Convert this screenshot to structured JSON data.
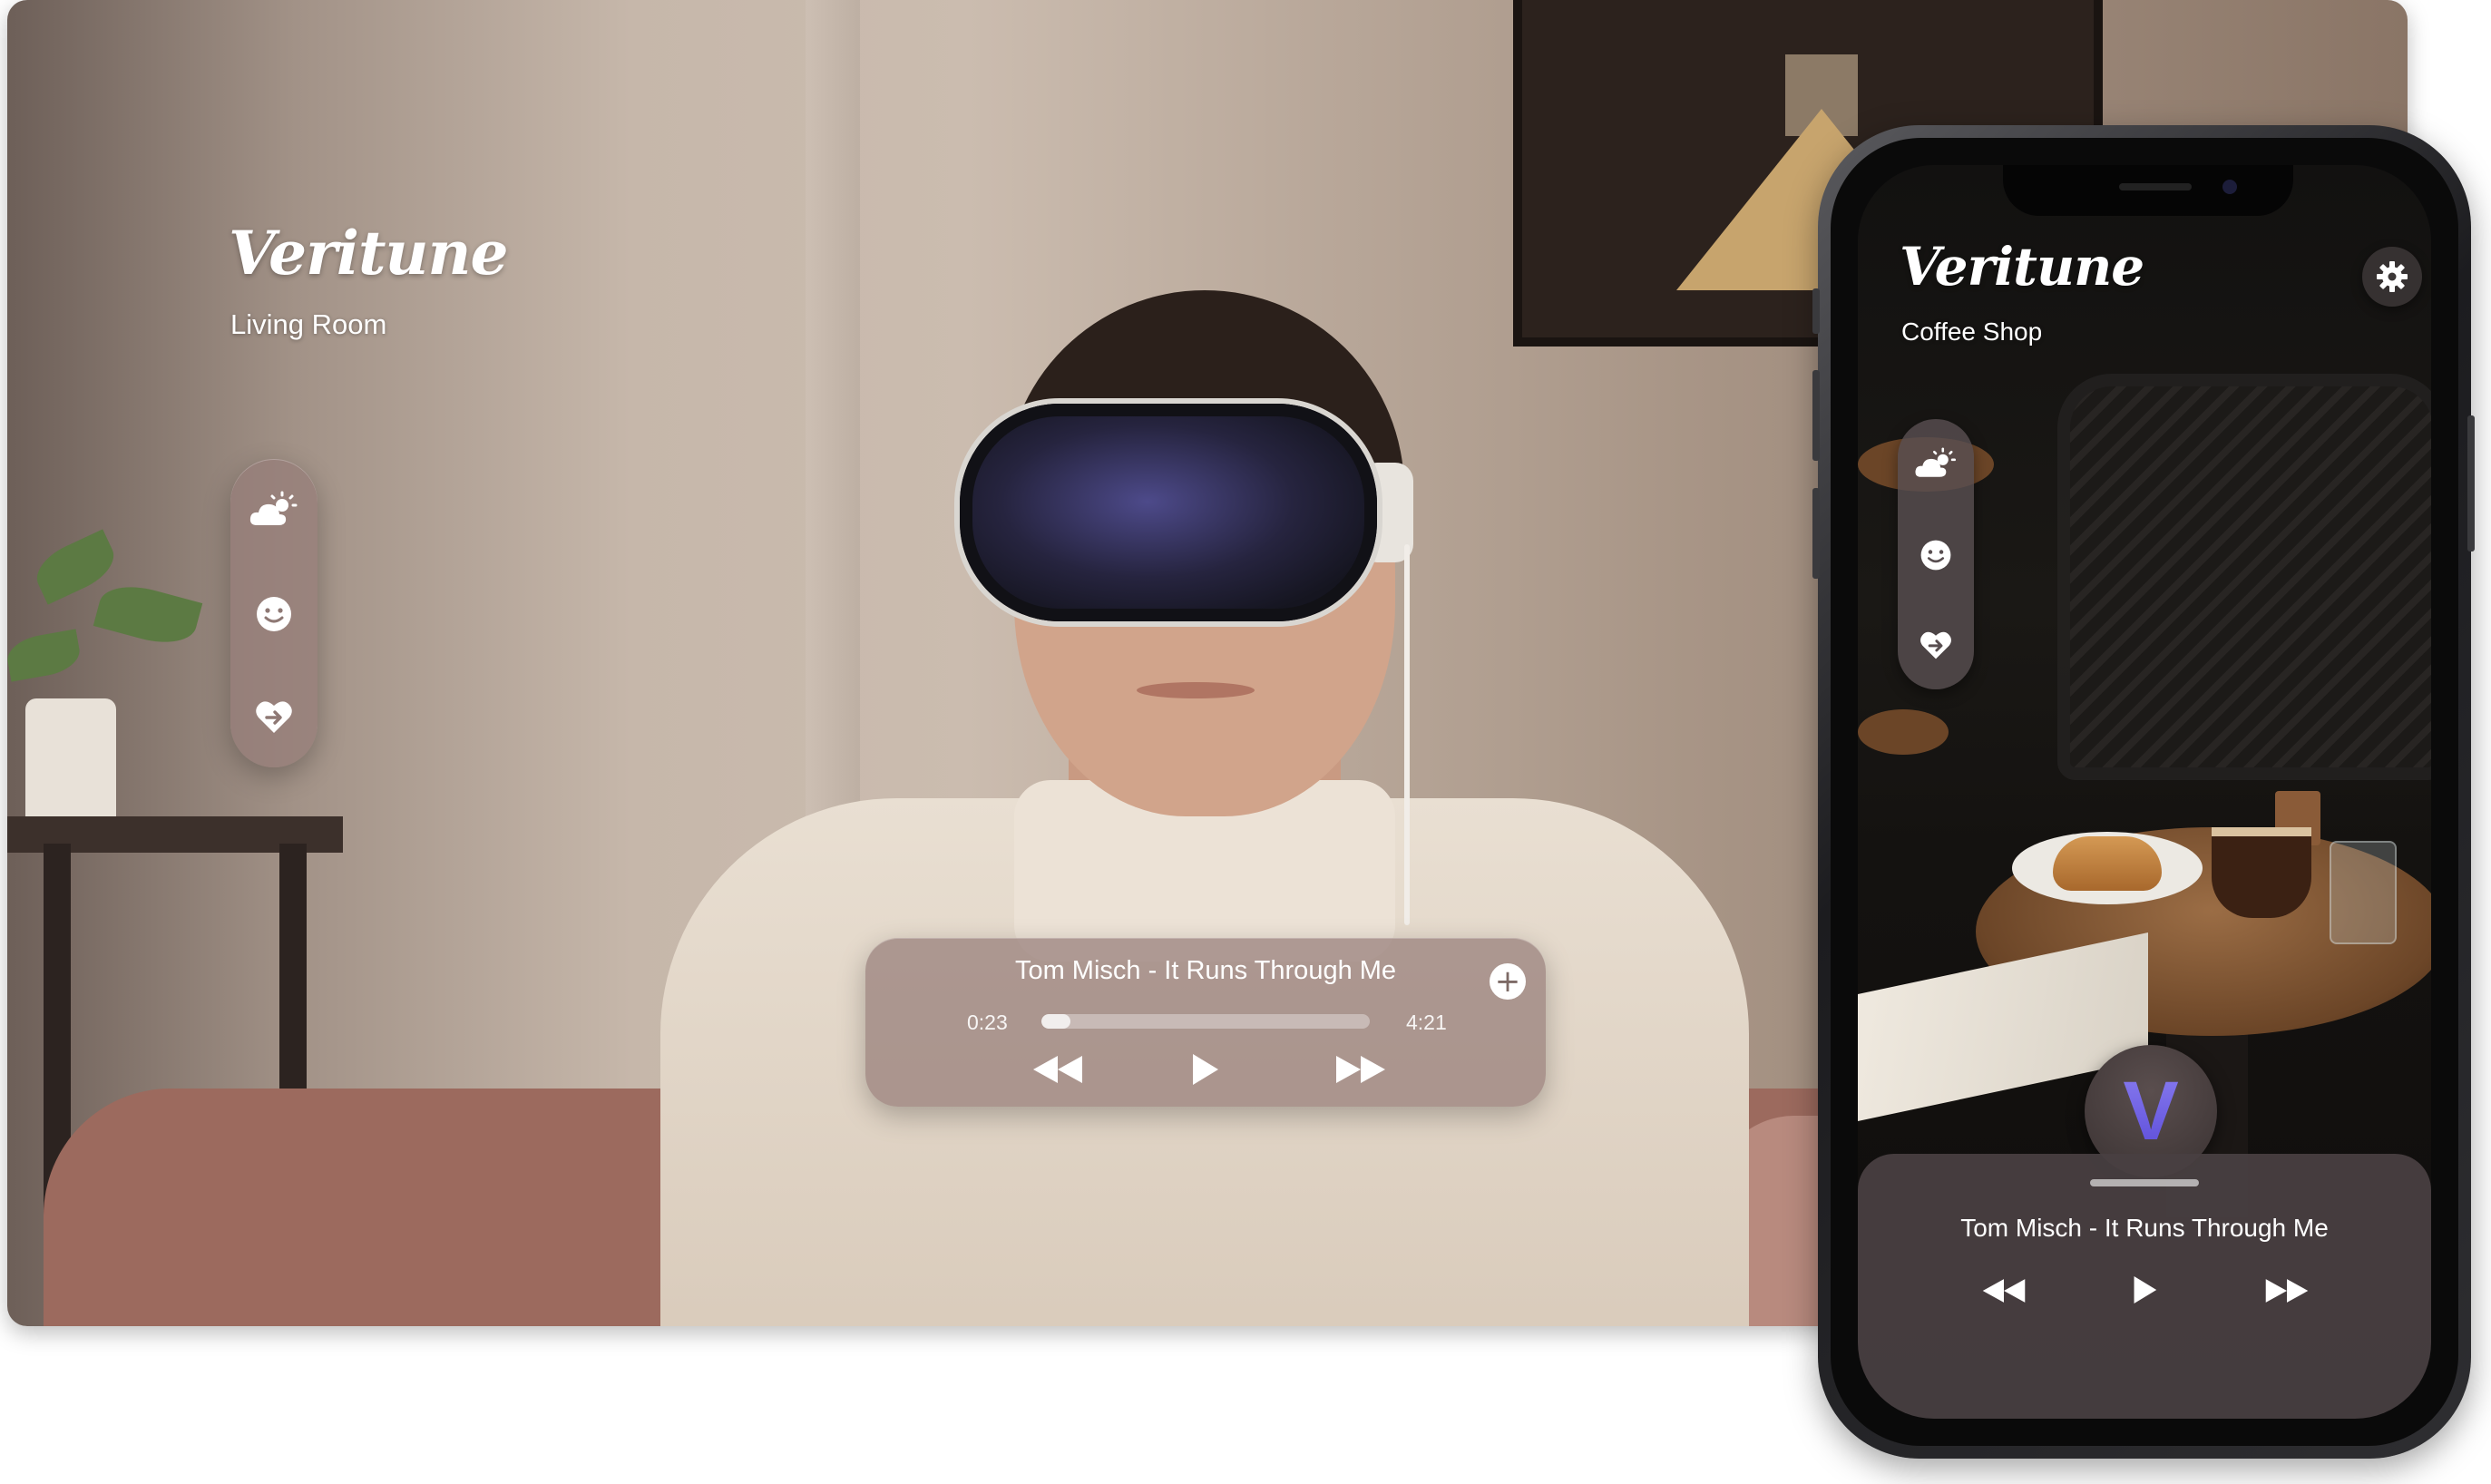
{
  "vr": {
    "brand": "Veritune",
    "room": "Living Room",
    "moods": [
      {
        "name": "weather-icon"
      },
      {
        "name": "smile-icon"
      },
      {
        "name": "heart-icon"
      }
    ],
    "player": {
      "track": "Tom Misch - It Runs Through Me",
      "elapsed": "0:23",
      "duration": "4:21",
      "progress_fraction": 0.088,
      "add_label": "+"
    }
  },
  "phone": {
    "brand": "Veritune",
    "room": "Coffee Shop",
    "logo_letter": "V",
    "player": {
      "track": "Tom Misch - It Runs Through Me"
    }
  },
  "colors": {
    "glass": "#967d78",
    "accent_v": "#6d5fe4",
    "white": "#ffffff"
  },
  "icons": [
    "weather-icon",
    "smile-icon",
    "heart-icon",
    "rewind-icon",
    "play-icon",
    "fast-forward-icon",
    "plus-icon",
    "gear-icon"
  ]
}
